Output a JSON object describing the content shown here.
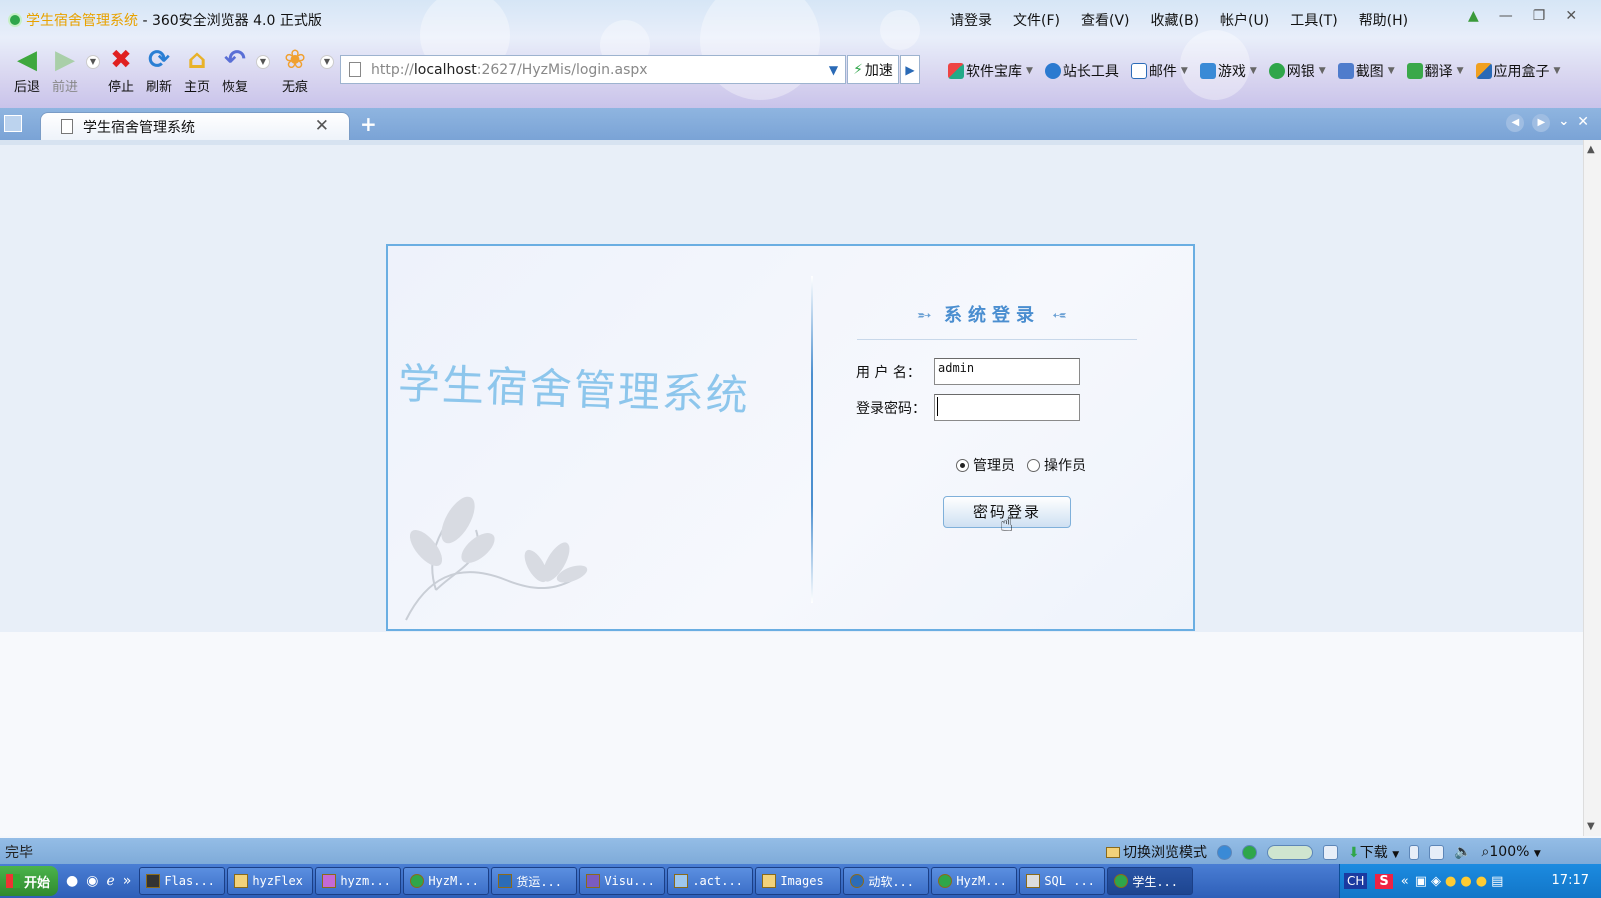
{
  "window": {
    "title_page": "学生宿舍管理系统",
    "title_sep": " - ",
    "title_app": "360安全浏览器 4.0 正式版",
    "menu": [
      "请登录",
      "文件(F)",
      "查看(V)",
      "收藏(B)",
      "帐户(U)",
      "工具(T)",
      "帮助(H)"
    ]
  },
  "toolbar": {
    "back": "后退",
    "forward": "前进",
    "stop": "停止",
    "refresh": "刷新",
    "home": "主页",
    "restore": "恢复",
    "incognito": "无痕"
  },
  "address": {
    "scheme": "http://",
    "host": "localhost",
    "rest": ":2627/HyzMis/login.aspx",
    "accelerate": "加速"
  },
  "tools": [
    "软件宝库",
    "站长工具",
    "邮件",
    "游戏",
    "网银",
    "截图",
    "翻译",
    "应用盒子"
  ],
  "tab": {
    "title": "学生宿舍管理系统"
  },
  "login": {
    "system_title": "学生宿舍管理系统",
    "panel_title": "系统登录",
    "username_label": "用 户 名：",
    "username_value": "admin",
    "password_label": "登录密码：",
    "password_value": "",
    "roles": [
      {
        "label": "管理员",
        "checked": true
      },
      {
        "label": "操作员",
        "checked": false
      }
    ],
    "submit": "密码登录"
  },
  "status": {
    "text": "完毕",
    "mode": "切换浏览模式",
    "download": "下载",
    "zoom": "100%"
  },
  "taskbar": {
    "start": "开始",
    "tasks": [
      "Flas...",
      "hyzFlex",
      "hyzm...",
      "HyzM...",
      "货运...",
      "Visu...",
      ".act...",
      "Images",
      "动软...",
      "HyzM...",
      "SQL ...",
      "学生..."
    ],
    "ime": "CH",
    "clock": "17:17"
  },
  "colors": {
    "accent": "#4a8ed0",
    "system_title": "#8dc6ec",
    "box_border": "#6aaee2"
  }
}
